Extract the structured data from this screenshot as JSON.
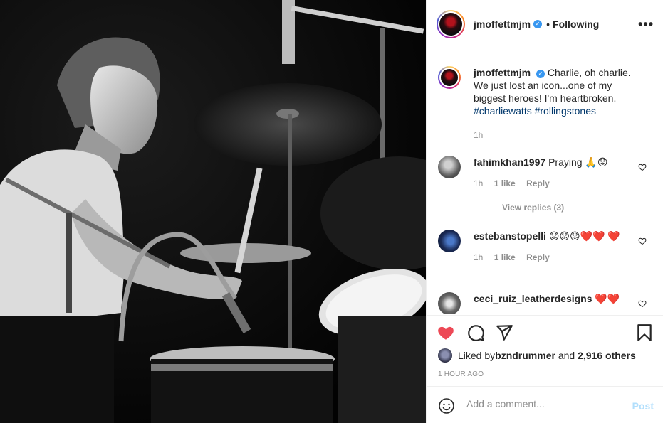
{
  "post": {
    "owner": {
      "username": "jmoffettmjm",
      "verified": true,
      "follow_status": "Following",
      "dot": "•"
    },
    "more_options": "•••",
    "caption": {
      "username": "jmoffettmjm",
      "text": "Charlie, oh charlie. We just lost an icon...one of my biggest heroes! I'm heartbroken.",
      "hashtags": [
        "#charliewatts",
        "#rollingstones"
      ],
      "time": "1h"
    },
    "comments": [
      {
        "username": "fahimkhan1997",
        "text": "Praying 🙏😟",
        "time": "1h",
        "likes": "1 like",
        "reply_label": "Reply",
        "view_replies": "View replies (3)"
      },
      {
        "username": "estebanstopelli",
        "text": "😟😟😟❤️❤️ ❤️",
        "time": "1h",
        "likes": "1 like",
        "reply_label": "Reply"
      },
      {
        "username": "ceci_ruiz_leatherdesigns",
        "text": "❤️❤️"
      }
    ],
    "likes": {
      "prefix": "Liked by ",
      "user": "bzndrummer",
      "middle": " and ",
      "count": "2,916 others"
    },
    "timestamp": "1 HOUR AGO",
    "add_comment": {
      "placeholder": "Add a comment...",
      "post_label": "Post"
    },
    "colors": {
      "like_red": "#ed4956",
      "link_blue": "#00376b",
      "post_disabled": "#b2dffc",
      "verified_blue": "#3897f0"
    },
    "icons": [
      "heart-icon",
      "comment-icon",
      "share-icon",
      "bookmark-icon",
      "emoji-icon",
      "verified-badge-icon",
      "more-options-icon"
    ]
  }
}
